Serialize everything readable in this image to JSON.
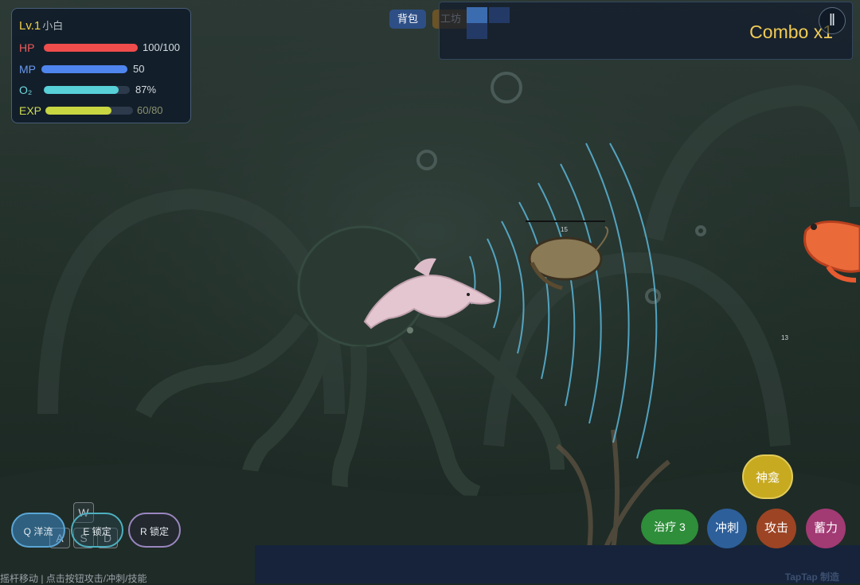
{
  "player": {
    "level": "Lv.1",
    "name": "小白",
    "stats": [
      {
        "label": "HP",
        "value_text": "100/100",
        "fraction": 1.0,
        "color": "#ef4c4c",
        "label_color": "#f25a5a"
      },
      {
        "label": "MP",
        "value_text": "50",
        "fraction": 1.0,
        "color": "#4f85ee",
        "label_color": "#6a98f0"
      },
      {
        "label": "O₂",
        "value_text": "87%",
        "fraction": 0.87,
        "color": "#57d0d8",
        "label_color": "#6fd8de"
      },
      {
        "label": "EXP",
        "value_text": "60/80",
        "fraction": 0.75,
        "color": "#c8d642",
        "label_color": "#d0dc52"
      }
    ]
  },
  "top_bar": {
    "bag_label": "背包",
    "workshop_label": "工坊",
    "combo": "Combo x1",
    "pause_icon": "pause-icon"
  },
  "enemies": [
    {
      "name": "shrimp",
      "hp_text": "15"
    },
    {
      "name": "red-shrimp",
      "hp_text": "13"
    }
  ],
  "skills": [
    {
      "key": "Q",
      "label": "Q 洋流",
      "color": "#5aa6d6"
    },
    {
      "key": "E",
      "label": "E 锁定",
      "color": "#4db0c0"
    },
    {
      "key": "R",
      "label": "R 锁定",
      "color": "#9a86c0"
    }
  ],
  "movement_keys": [
    "W",
    "A",
    "S",
    "D"
  ],
  "hint_text": "摇杆移动 | 点击按钮攻击/冲刺/技能",
  "actions": {
    "shrine": "神龛",
    "heal": "治疗 3",
    "dash": "冲刺",
    "attack": "攻击",
    "charge": "蓄力"
  },
  "watermark": "TapTap 制造"
}
